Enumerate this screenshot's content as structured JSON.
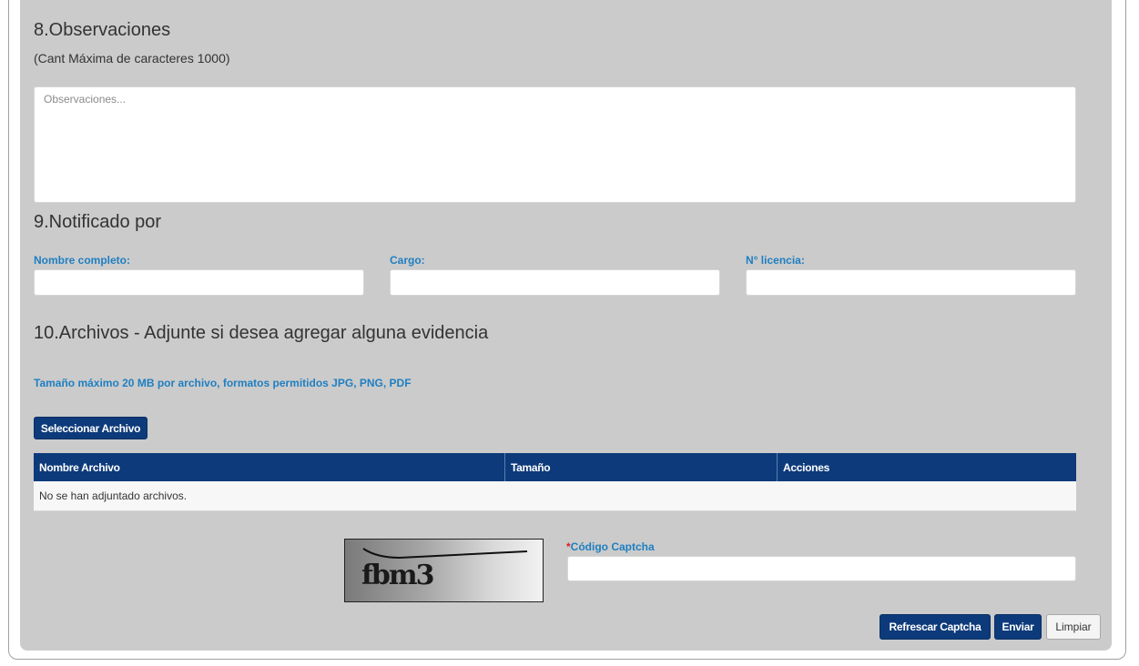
{
  "observations": {
    "title": "8.Observaciones",
    "max_chars_note": "(Cant Máxima de caracteres 1000)",
    "placeholder": "Observaciones..."
  },
  "notified_by": {
    "title": "9.Notificado por",
    "fields": [
      {
        "label": "Nombre completo:",
        "value": ""
      },
      {
        "label": "Cargo:",
        "value": ""
      },
      {
        "label": "N° licencia:",
        "value": ""
      }
    ]
  },
  "files": {
    "title": "10.Archivos - Adjunte si desea agregar alguna evidencia",
    "info": "Tamaño máximo 20 MB por archivo, formatos permitidos JPG, PNG, PDF",
    "select_button": "Seleccionar Archivo",
    "table": {
      "columns": [
        "Nombre Archivo",
        "Tamaño",
        "Acciones"
      ],
      "empty_message": "No se han adjuntado archivos."
    }
  },
  "captcha": {
    "image_text": "fbm3",
    "required_mark": "*",
    "label": "Código Captcha",
    "value": ""
  },
  "actions": {
    "refresh_captcha": "Refrescar Captcha",
    "send": "Enviar",
    "clear": "Limpiar"
  },
  "colors": {
    "panel_bg": "#cbcbcb",
    "primary": "#0d3a7a",
    "label_blue": "#1f7fc1",
    "required_red": "#d9232e"
  }
}
